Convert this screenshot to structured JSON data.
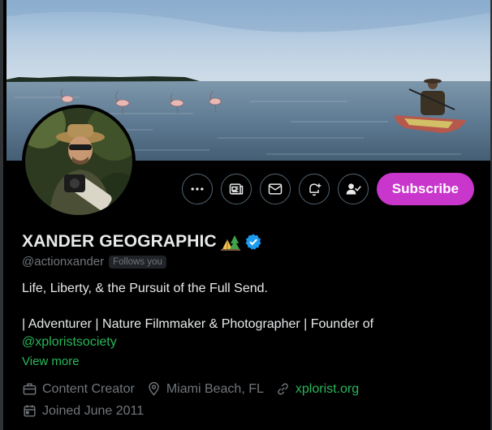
{
  "profile": {
    "display_name": "XANDER GEOGRAPHIC",
    "handle": "@actionxander",
    "follows_you": "Follows you",
    "bio_line1": "Life, Liberty, & the Pursuit of the Full Send.",
    "bio_line2": "| Adventurer | Nature Filmmaker & Photographer | Founder of",
    "bio_mention": "@xploristsociety",
    "view_more": "View more",
    "category": "Content Creator",
    "location": "Miami Beach, FL",
    "website": "xplorist.org",
    "joined": "Joined June 2011"
  },
  "actions": {
    "subscribe_label": "Subscribe",
    "icons": [
      "more-icon",
      "newsletter-icon",
      "message-icon",
      "notify-icon",
      "following-icon"
    ]
  },
  "colors": {
    "accent_link": "#27b85a",
    "subscribe_bg": "#c936cc",
    "verified": "#1d9bf0",
    "background": "#000000",
    "muted_text": "#71767b"
  }
}
